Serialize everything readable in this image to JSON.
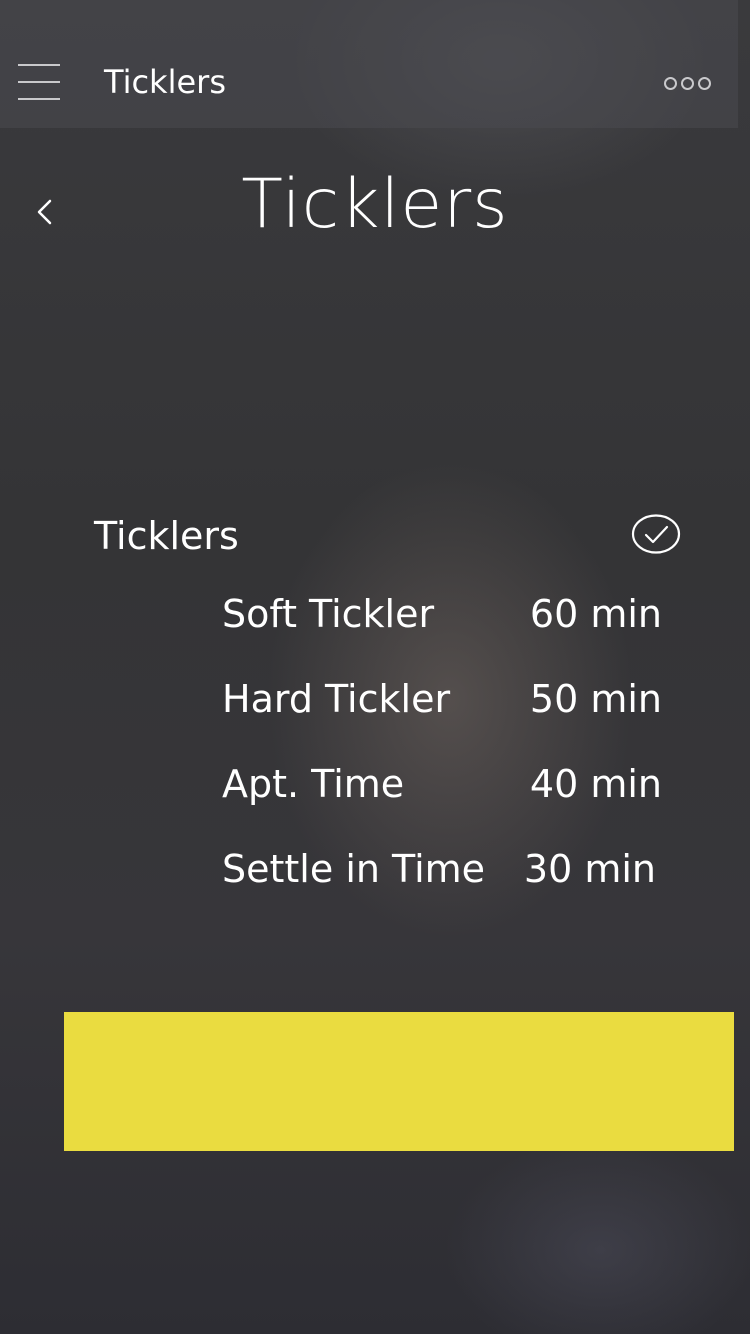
{
  "header": {
    "title": "Ticklers",
    "menu_icon": "hamburger-menu-icon",
    "more_icon": "more-options-icon"
  },
  "page": {
    "back_icon": "chevron-left-icon",
    "title": "Ticklers"
  },
  "section": {
    "label": "Ticklers",
    "confirm_icon": "check-circle-icon",
    "items": [
      {
        "name": "Soft Tickler",
        "value": "60 min"
      },
      {
        "name": "Hard Tickler",
        "value": "50 min"
      },
      {
        "name": "Apt. Time",
        "value": "40 min"
      },
      {
        "name": "Settle in Time",
        "value": "30 min"
      }
    ]
  },
  "action": {
    "label": "",
    "color": "#eadc40"
  },
  "colors": {
    "background": "#363638",
    "accent_yellow": "#eadc40",
    "text": "#ffffff"
  }
}
